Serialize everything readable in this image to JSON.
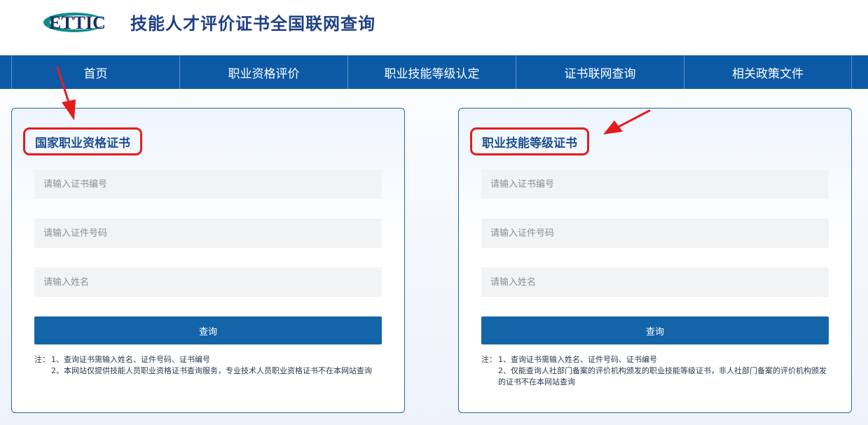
{
  "header": {
    "logo_text": "ETTIC",
    "site_title": "技能人才评价证书全国联网查询"
  },
  "nav": {
    "items": [
      {
        "label": "首页"
      },
      {
        "label": "职业资格评价"
      },
      {
        "label": "职业技能等级认定"
      },
      {
        "label": "证书联网查询"
      },
      {
        "label": "相关政策文件"
      }
    ]
  },
  "panels": [
    {
      "title": "国家职业资格证书",
      "cert_no_placeholder": "请输入证书编号",
      "id_no_placeholder": "请输入证件号码",
      "name_placeholder": "请输入姓名",
      "button_label": "查询",
      "note_prefix": "注：",
      "note_1": "1、查询证书需输入姓名、证件号码、证书编号",
      "note_2": "2、本网站仅提供技能人员职业资格证书查询服务，专业技术人员职业资格证书不在本网站查询"
    },
    {
      "title": "职业技能等级证书",
      "cert_no_placeholder": "请输入证书编号",
      "id_no_placeholder": "请输入证件号码",
      "name_placeholder": "请输入姓名",
      "button_label": "查询",
      "note_prefix": "注：",
      "note_1": "1、查询证书需输入姓名、证件号码、证书编号",
      "note_2": "2、仅能查询人社部门备案的评价机构颁发的职业技能等级证书，非人社部门备案的评价机构颁发的证书不在本网站查询"
    }
  ],
  "colors": {
    "nav_bg": "#0c5aa6",
    "button_bg": "#1465a8",
    "title_text": "#1f3f84",
    "highlight_red": "#e51c1c",
    "logo_teal": "#0e8d8a"
  }
}
